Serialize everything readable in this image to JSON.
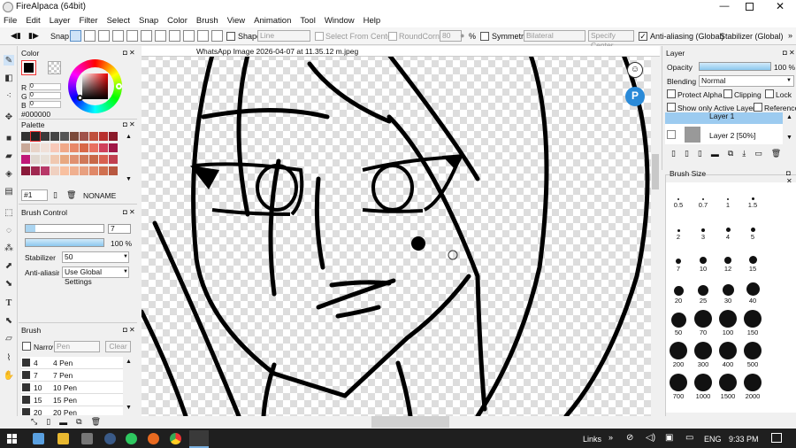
{
  "window": {
    "title": "FireAlpaca (64bit)"
  },
  "menu": [
    "File",
    "Edit",
    "Layer",
    "Filter",
    "Select",
    "Snap",
    "Color",
    "Brush",
    "View",
    "Animation",
    "Tool",
    "Window",
    "Help"
  ],
  "toolbar": {
    "snap": "Snap",
    "shape_label": "Shape",
    "shape_value": "Line",
    "select_from_center": "Select From Center",
    "round_corner": "RoundCorner",
    "round_corner_value": "80",
    "percent": "%",
    "symmetry": "Symmetry",
    "symmetry_value": "Bilateral",
    "specify_center": "Specify Center",
    "anti_aliasing": "Anti-aliasing (Global)",
    "stabilizer": "Stabilizer (Global)"
  },
  "color_panel": {
    "title": "Color",
    "r": "R",
    "g": "G",
    "b": "B",
    "r_val": "0",
    "g_val": "0",
    "b_val": "0",
    "hex": "#000000",
    "fg": "#000000"
  },
  "palette_panel": {
    "title": "Palette",
    "index": "#1",
    "name": "NONAME",
    "colors": [
      "#333333",
      "#222222",
      "#3a3a3a",
      "#444444",
      "#555555",
      "#7b4a3a",
      "#a0524a",
      "#c0503c",
      "#b8302e",
      "#8a1a2a",
      "#c8a898",
      "#e8d4c8",
      "#f0e0d8",
      "#f8c8b8",
      "#f0a888",
      "#e88868",
      "#d86848",
      "#e87060",
      "#d0405c",
      "#a01848",
      "#c01878",
      "#e0d8d0",
      "#e8e0d8",
      "#f0c8b0",
      "#e8a880",
      "#e09070",
      "#d07858",
      "#c86848",
      "#d86050",
      "#c04050",
      "#8a1a3a",
      "#a02850",
      "#b83868",
      "#f0d0c0",
      "#f8c0a0",
      "#f0b090",
      "#e8a080",
      "#e08868",
      "#d07050",
      "#b85840"
    ]
  },
  "brush_control": {
    "title": "Brush Control",
    "size": "7",
    "opacity": "100 %",
    "stabilizer_label": "Stabilizer",
    "stabilizer_value": "50",
    "aa_label": "Anti-aliasing",
    "aa_value": "Use Global Settings"
  },
  "brush_panel": {
    "title": "Brush",
    "narrow": "Narrow",
    "search_placeholder": "Pen",
    "clear": "Clear",
    "items": [
      {
        "size": "4",
        "name": "4 Pen"
      },
      {
        "size": "7",
        "name": "7 Pen"
      },
      {
        "size": "10",
        "name": "10 Pen"
      },
      {
        "size": "15",
        "name": "15 Pen"
      },
      {
        "size": "20",
        "name": "20 Pen"
      }
    ]
  },
  "document": {
    "tab_title": "WhatsApp Image 2026-04-07 at 11.35.12 m.jpeg"
  },
  "layer_panel": {
    "title": "Layer",
    "opacity_label": "Opacity",
    "opacity_value": "100 %",
    "blending_label": "Blending",
    "blending_value": "Normal",
    "protect_alpha": "Protect Alpha",
    "clipping": "Clipping",
    "lock": "Lock",
    "show_only_active": "Show only Active Layer",
    "reference": "Reference",
    "layers": [
      {
        "name": "Layer 1"
      },
      {
        "name": "Layer 2 [50%]"
      }
    ]
  },
  "brush_size_panel": {
    "title": "Brush Size",
    "sizes": [
      "0.5",
      "0.7",
      "1",
      "1.5",
      "2",
      "3",
      "4",
      "5",
      "7",
      "10",
      "12",
      "15",
      "20",
      "25",
      "30",
      "40",
      "50",
      "70",
      "100",
      "150",
      "200",
      "300",
      "400",
      "500",
      "700",
      "1000",
      "1500",
      "2000"
    ]
  },
  "taskbar": {
    "links": "Links",
    "lang": "ENG",
    "time": "9:33 PM"
  }
}
